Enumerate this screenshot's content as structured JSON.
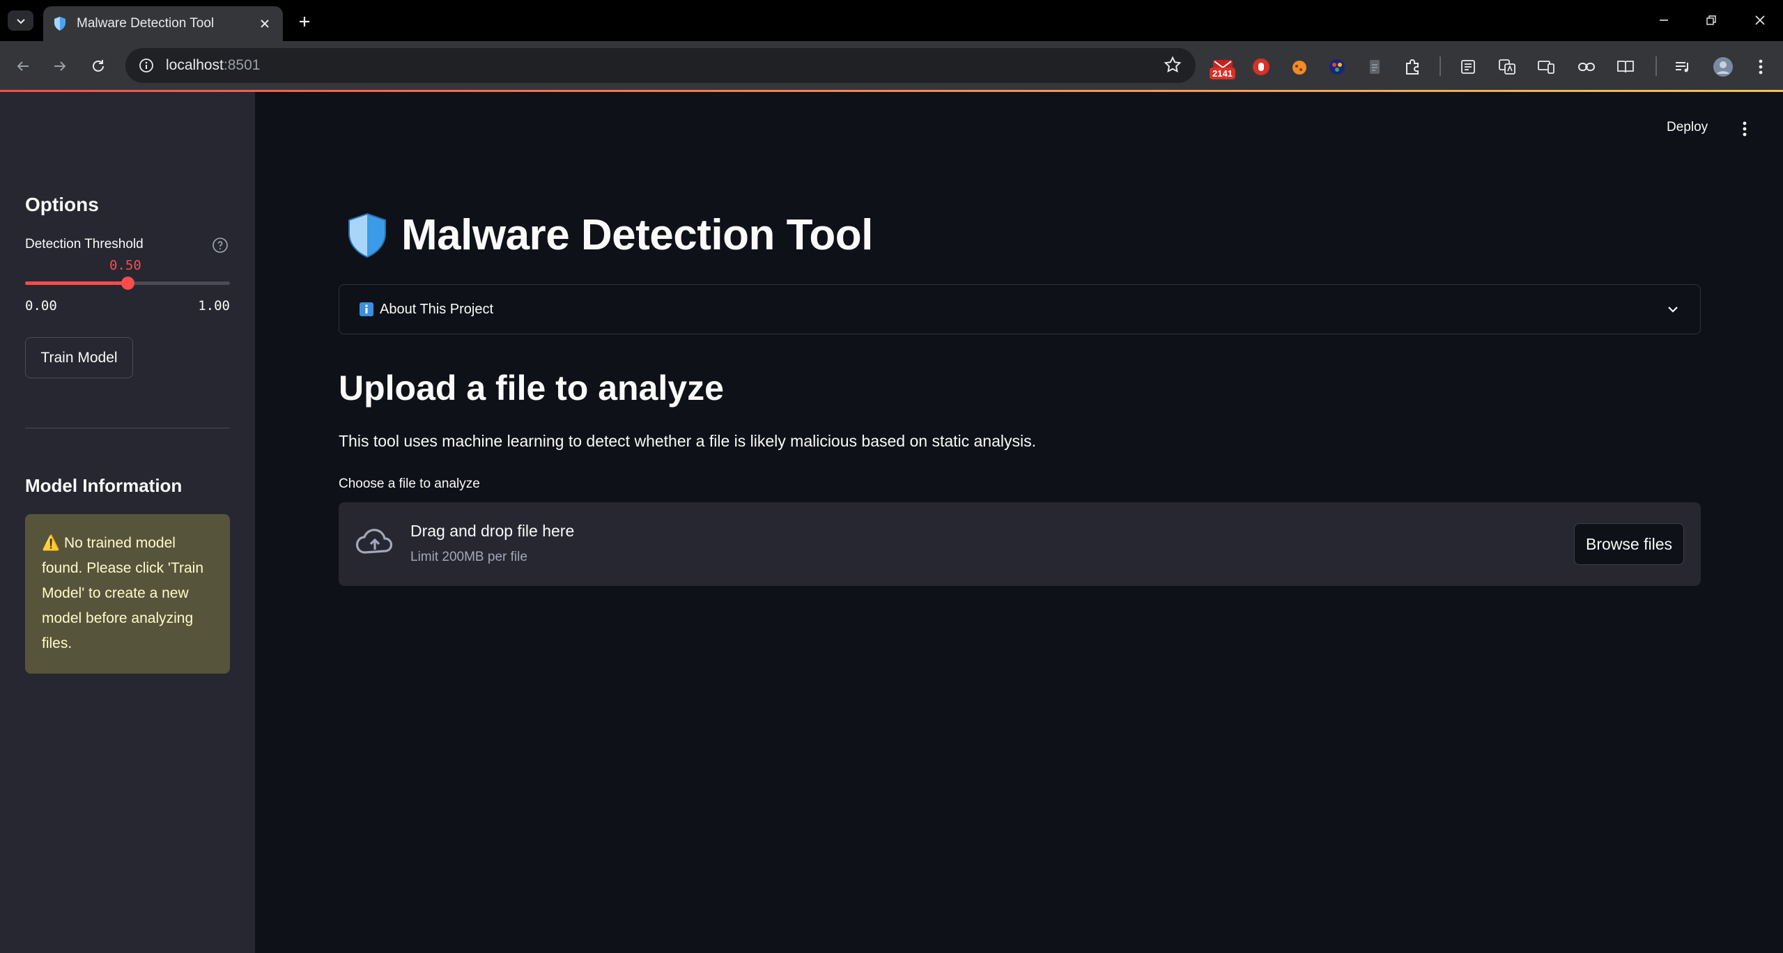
{
  "browser": {
    "tab_title": "Malware Detection Tool",
    "url_host": "localhost",
    "url_port": ":8501",
    "extension_badge": "2141"
  },
  "app": {
    "deploy_label": "Deploy",
    "title": "Malware Detection Tool",
    "about_label": "About This Project",
    "upload_heading": "Upload a file to analyze",
    "description": "This tool uses machine learning to detect whether a file is likely malicious based on static analysis.",
    "uploader": {
      "label": "Choose a file to analyze",
      "drag_text": "Drag and drop file here",
      "limit_text": "Limit 200MB per file",
      "browse_label": "Browse files"
    }
  },
  "sidebar": {
    "options_heading": "Options",
    "threshold": {
      "label": "Detection Threshold",
      "value": "0.50",
      "value_fraction": 0.5,
      "min": "0.00",
      "max": "1.00"
    },
    "train_button": "Train Model",
    "model_heading": "Model Information",
    "warning_icon": "⚠️",
    "warning_text": "No trained model found. Please click 'Train Model' to create a new model before analyzing files."
  },
  "colors": {
    "accent": "#ff4b4b",
    "background": "#0e1117",
    "sidebar": "#262730",
    "warning_bg": "#56543a",
    "warning_text": "#fffbcc"
  }
}
